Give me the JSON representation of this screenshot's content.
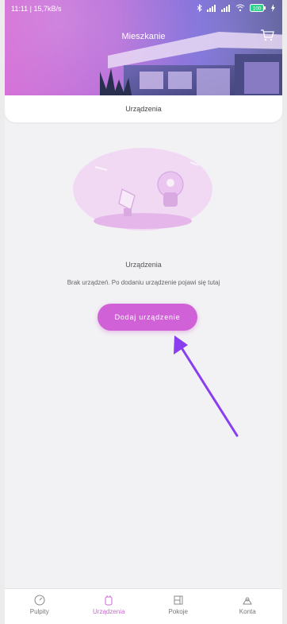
{
  "status_bar": {
    "time_speed": "11:11 | 15,7kB/s",
    "battery": "100"
  },
  "header": {
    "title": "Mieszkanie"
  },
  "section": {
    "title": "Urządzenia"
  },
  "empty_state": {
    "title": "Urządzenia",
    "description": "Brak urządzeń. Po dodaniu urządzenie pojawi się tutaj"
  },
  "actions": {
    "add_device_label": "Dodaj urządzenie"
  },
  "bottom_nav": {
    "items": [
      {
        "label": "Pulpity",
        "icon": "dashboard-icon"
      },
      {
        "label": "Urządzenia",
        "icon": "device-icon",
        "active": true
      },
      {
        "label": "Pokoje",
        "icon": "rooms-icon"
      },
      {
        "label": "Konta",
        "icon": "account-icon"
      }
    ]
  },
  "colors": {
    "accent": "#d061d6",
    "background": "#f2f2f4",
    "header_start": "#d36ad6",
    "header_end": "#5a5c9a"
  }
}
